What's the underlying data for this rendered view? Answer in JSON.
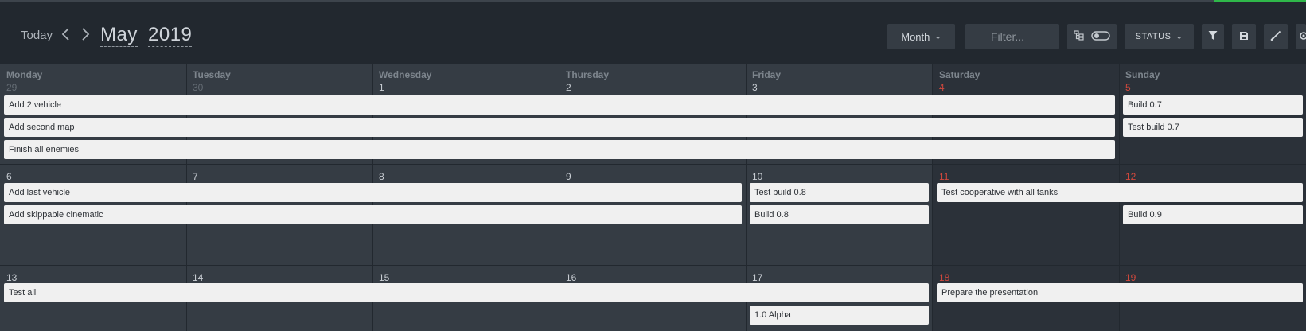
{
  "toolbar": {
    "today_label": "Today",
    "month_label": "May",
    "year_label": "2019",
    "view_label": "Month",
    "filter_placeholder": "Filter...",
    "status_label": "STATUS"
  },
  "calendar": {
    "day_names": [
      "Monday",
      "Tuesday",
      "Wednesday",
      "Thursday",
      "Friday",
      "Saturday",
      "Sunday"
    ],
    "weeks": [
      {
        "days": [
          "29",
          "30",
          "1",
          "2",
          "3",
          "4",
          "5"
        ]
      },
      {
        "days": [
          "6",
          "7",
          "8",
          "9",
          "10",
          "11",
          "12"
        ]
      },
      {
        "days": [
          "13",
          "14",
          "15",
          "16",
          "17",
          "18",
          "19"
        ]
      }
    ],
    "events": [
      {
        "title": "Add 2 vehicle",
        "week": 0,
        "start": 0,
        "span": 6,
        "lane": 0
      },
      {
        "title": "Add second map",
        "week": 0,
        "start": 0,
        "span": 6,
        "lane": 1
      },
      {
        "title": "Finish all enemies",
        "week": 0,
        "start": 0,
        "span": 6,
        "lane": 2
      },
      {
        "title": "Build 0.7",
        "week": 0,
        "start": 6,
        "span": 1,
        "lane": 0
      },
      {
        "title": "Test build 0.7",
        "week": 0,
        "start": 6,
        "span": 1,
        "lane": 1
      },
      {
        "title": "Add last vehicle",
        "week": 1,
        "start": 0,
        "span": 4,
        "lane": 0
      },
      {
        "title": "Add skippable cinematic",
        "week": 1,
        "start": 0,
        "span": 4,
        "lane": 1
      },
      {
        "title": "Test build 0.8",
        "week": 1,
        "start": 4,
        "span": 1,
        "lane": 0
      },
      {
        "title": "Build 0.8",
        "week": 1,
        "start": 4,
        "span": 1,
        "lane": 1
      },
      {
        "title": "Test cooperative with all tanks",
        "week": 1,
        "start": 5,
        "span": 2,
        "lane": 0
      },
      {
        "title": "Build 0.9",
        "week": 1,
        "start": 6,
        "span": 1,
        "lane": 1
      },
      {
        "title": "Test all",
        "week": 2,
        "start": 0,
        "span": 5,
        "lane": 0
      },
      {
        "title": "Prepare the presentation",
        "week": 2,
        "start": 5,
        "span": 2,
        "lane": 0
      },
      {
        "title": "1.0 Alpha",
        "week": 2,
        "start": 4,
        "span": 1,
        "lane": 1
      }
    ]
  },
  "colors": {
    "header_bg": "#22282f",
    "weekday_cell": "#353c44",
    "weekend_cell": "#2b3139",
    "weekend_number": "#d0483d",
    "event_bg": "#f0f0f0",
    "accent": "#2fb84a"
  },
  "icons": {
    "prev": "chevron-left-icon",
    "next": "chevron-right-icon",
    "search": "search-icon",
    "hierarchy": "hierarchy-icon",
    "toggle": "toggle-icon",
    "filter": "funnel-icon",
    "save": "save-icon",
    "brush": "brush-icon",
    "settings": "gear-icon"
  }
}
